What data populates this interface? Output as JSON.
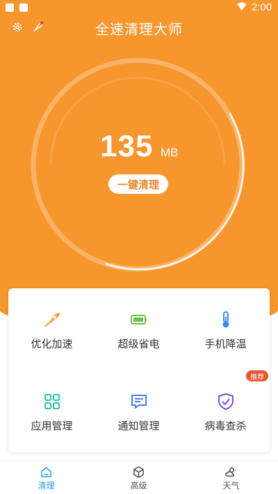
{
  "status_bar": {
    "time": "2:00"
  },
  "header": {
    "title": "全速清理大师",
    "settings_icon": "gear-icon",
    "boost_icon": "rocket-icon"
  },
  "storage": {
    "value": "135",
    "unit": "MB",
    "clean_button": "一键清理"
  },
  "functions": [
    {
      "label": "优化加速",
      "icon": "rocket-icon"
    },
    {
      "label": "超级省电",
      "icon": "battery-icon"
    },
    {
      "label": "手机降温",
      "icon": "thermometer-icon"
    },
    {
      "label": "应用管理",
      "icon": "grid-icon"
    },
    {
      "label": "通知管理",
      "icon": "message-icon"
    },
    {
      "label": "病毒查杀",
      "icon": "shield-check-icon"
    }
  ],
  "badge": "推荐",
  "bottom_nav": [
    {
      "label": "清理",
      "icon": "home-icon",
      "active": true
    },
    {
      "label": "高级",
      "icon": "cube-icon",
      "active": false
    },
    {
      "label": "天气",
      "icon": "weather-icon",
      "active": false
    }
  ],
  "colors": {
    "primary_orange": "#F7962D",
    "accent_blue": "#2A9BE0",
    "badge_red": "#E8552F",
    "rocket_orange": "#F0A030",
    "battery_green": "#6CC04A",
    "thermo_blue": "#3A8EE8",
    "grid_teal": "#2BC4A8",
    "message_blue": "#4A7FE0",
    "shield_purple": "#7B4FD6"
  }
}
